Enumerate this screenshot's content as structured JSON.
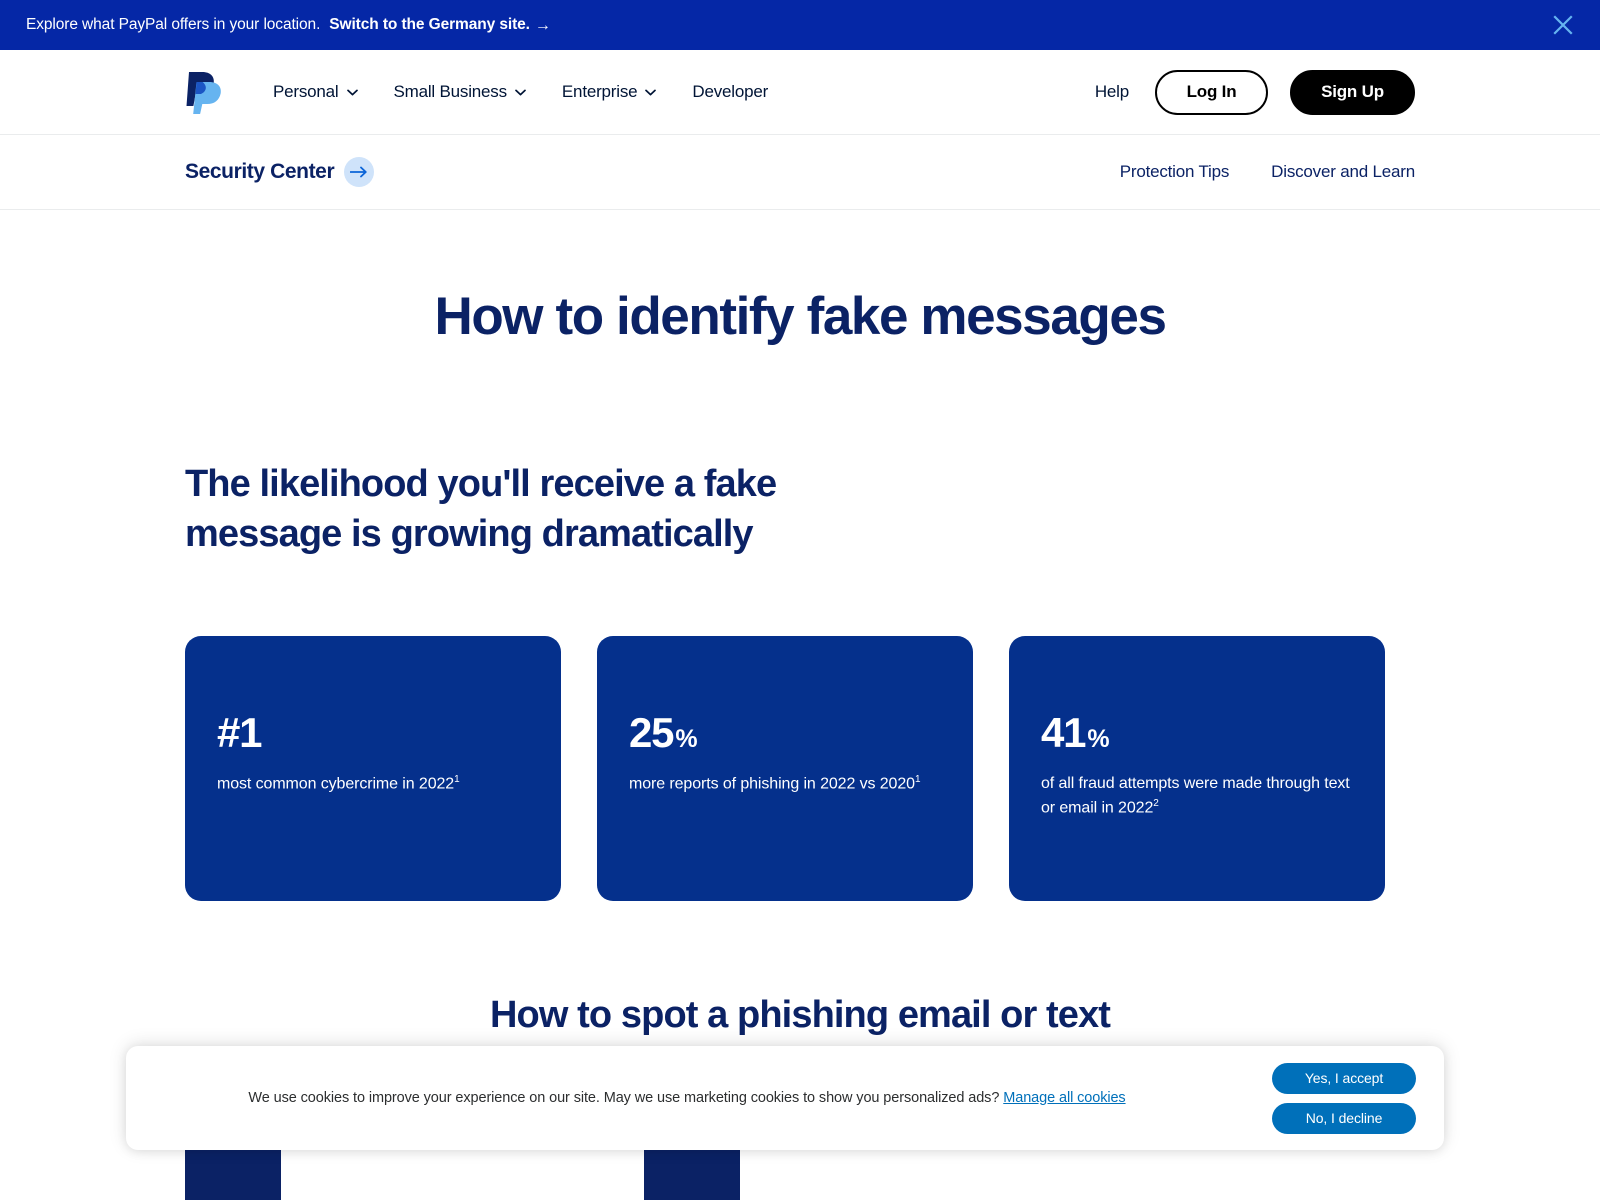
{
  "locale_banner": {
    "text": "Explore what PayPal offers in your location.",
    "link_label": "Switch to the Germany site.",
    "arrow": "→",
    "close_icon": "close-icon",
    "bg_color": "#0527a6"
  },
  "main_nav": {
    "logo_alt": "paypal-logo",
    "links": [
      {
        "label": "Personal",
        "has_chevron": true
      },
      {
        "label": "Small Business",
        "has_chevron": true
      },
      {
        "label": "Enterprise",
        "has_chevron": true
      },
      {
        "label": "Developer",
        "has_chevron": false
      }
    ],
    "help_label": "Help",
    "login_label": "Log In",
    "signup_label": "Sign Up"
  },
  "sub_nav": {
    "brand": "Security Center",
    "brand_arrow": "→",
    "links": [
      {
        "label": "Protection Tips"
      },
      {
        "label": "Discover and Learn"
      }
    ]
  },
  "main": {
    "page_title": "How to identify fake messages",
    "section_heading": "The likelihood you'll receive a fake message is growing dramatically",
    "spot_heading": "How to spot a phishing email or text",
    "stat_cards": [
      {
        "figure": "#1",
        "unit": "",
        "description": "most common cybercrime in 2022",
        "footnote": "1"
      },
      {
        "figure": "25",
        "unit": "%",
        "description": "more reports of phishing in 2022 vs 2020",
        "footnote": "1"
      },
      {
        "figure": "41",
        "unit": "%",
        "description": "of all fraud attempts were made through text or email in 2022",
        "footnote": "2"
      }
    ]
  },
  "cookie_banner": {
    "message": "We use cookies to improve your experience on our site. May we use marketing cookies to show you personalized ads?",
    "manage_label": "Manage all cookies",
    "accept_label": "Yes, I accept",
    "decline_label": "No, I decline",
    "button_color": "#0070ba"
  },
  "theme": {
    "navy": "#0b2265",
    "card_navy": "#05308c",
    "banner_blue": "#0527a6",
    "link_blue": "#0070ba",
    "logo_light": "#66b4f0"
  }
}
